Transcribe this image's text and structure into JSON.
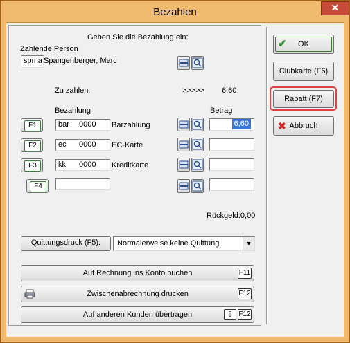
{
  "window": {
    "title": "Bezahlen",
    "close_glyph": "✕"
  },
  "header": {
    "instruction": "Geben Sie die Bezahlung ein:",
    "person_label": "Zahlende Person",
    "person_code": "spma",
    "person_name": "Spangenberger, Marc"
  },
  "summary": {
    "due_label": "Zu zahlen:",
    "arrows": ">>>>>",
    "due_value": "6,60",
    "change_label": "Rückgeld:",
    "change_value": "0,00"
  },
  "payments": {
    "col_payment": "Bezahlung",
    "col_amount": "Betrag",
    "rows": [
      {
        "key": "F1",
        "code": "bar",
        "number": "0000",
        "label": "Barzahlung",
        "amount": "6,60"
      },
      {
        "key": "F2",
        "code": "ec",
        "number": "0000",
        "label": "EC-Karte",
        "amount": ""
      },
      {
        "key": "F3",
        "code": "kk",
        "number": "0000",
        "label": "Kreditkarte",
        "amount": ""
      },
      {
        "key": "F4",
        "code": "",
        "number": "",
        "label": "",
        "amount": ""
      }
    ]
  },
  "receipt": {
    "button_label": "Quittungsdruck (F5):",
    "select_value": "Normalerweise keine Quittung"
  },
  "actions": {
    "account": {
      "label": "Auf Rechnung ins Konto buchen",
      "key": "F11"
    },
    "interim": {
      "label": "Zwischenabrechnung drucken",
      "key": "F12"
    },
    "transfer": {
      "label": "Auf anderen Kunden übertragen",
      "key": "F12"
    }
  },
  "side": {
    "ok": "OK",
    "club": "Clubkarte (F6)",
    "discount": "Rabatt (F7)",
    "cancel": "Abbruch"
  },
  "colors": {
    "highlight": "#3a75d8",
    "frame_red": "#e04040",
    "accent_green": "#2e8b2e"
  }
}
